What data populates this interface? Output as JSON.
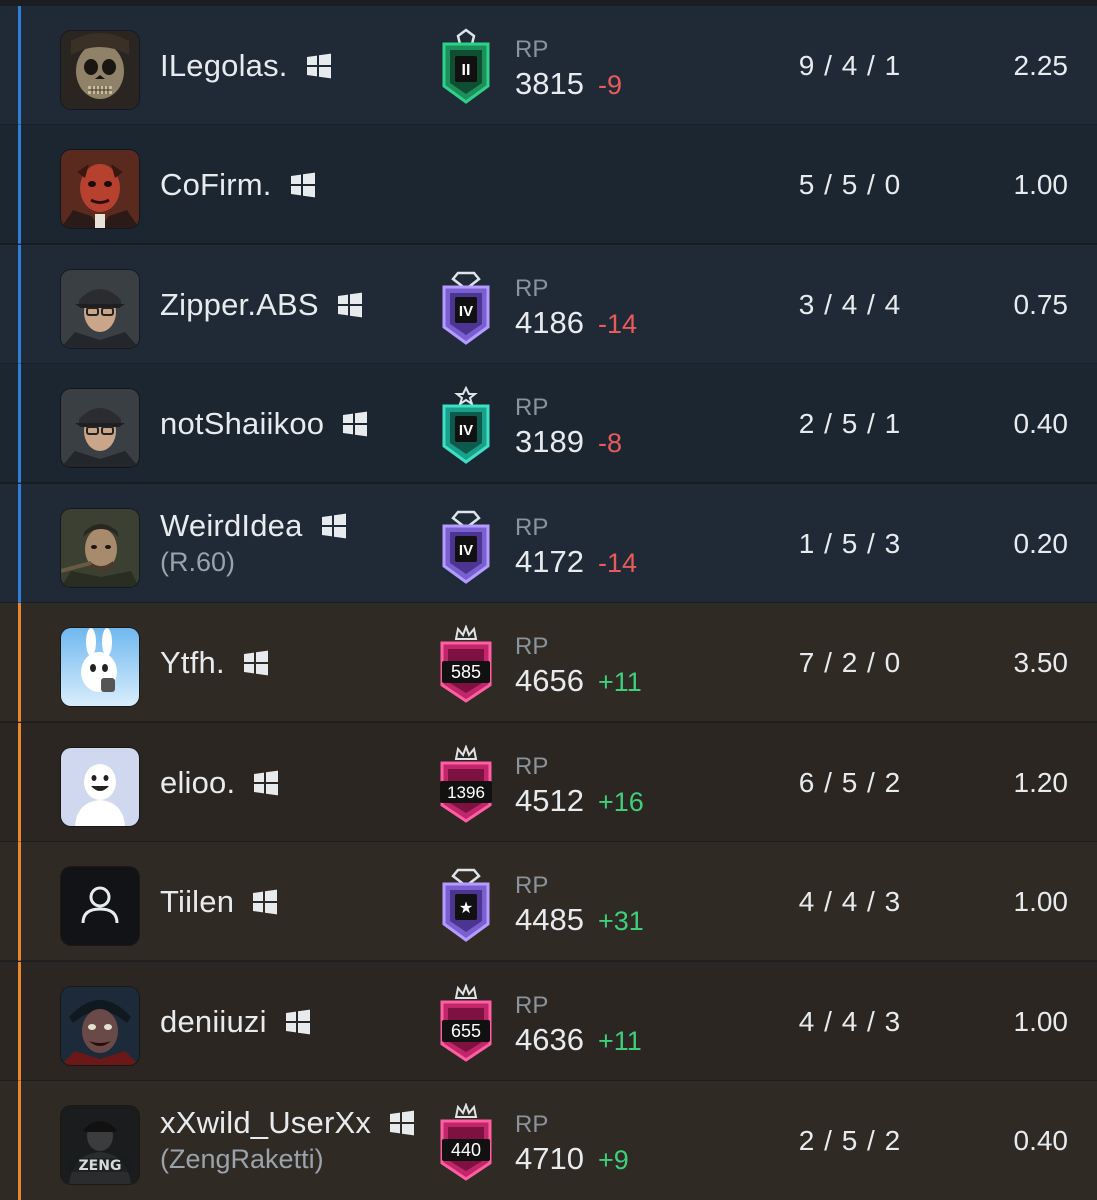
{
  "colors": {
    "team_blue": "#2f7fd6",
    "team_orange": "#e8872b",
    "rp_negative": "#e85b5b",
    "rp_positive": "#3ecf7a"
  },
  "rp_label": "RP",
  "players": [
    {
      "name": "ILegolas.",
      "platform_icon": "windows-icon",
      "sub": "",
      "rank_icon": "emerald-II-rank-icon",
      "rank_text": "II",
      "rp": "3815",
      "rp_delta": "-9",
      "kda": "9 / 4 / 1",
      "kd": "2.25",
      "team": "blue"
    },
    {
      "name": "CoFirm.",
      "platform_icon": "windows-icon",
      "sub": "",
      "rank_icon": "",
      "rank_text": "",
      "rp": "",
      "rp_delta": "",
      "kda": "5 / 5 / 0",
      "kd": "1.00",
      "team": "blue"
    },
    {
      "name": "Zipper.ABS",
      "platform_icon": "windows-icon",
      "sub": "",
      "rank_icon": "diamond-IV-rank-icon",
      "rank_text": "IV",
      "rp": "4186",
      "rp_delta": "-14",
      "kda": "3 / 4 / 4",
      "kd": "0.75",
      "team": "blue"
    },
    {
      "name": "notShaiikoo",
      "platform_icon": "windows-icon",
      "sub": "",
      "rank_icon": "emerald-IV-rank-icon",
      "rank_text": "IV",
      "rp": "3189",
      "rp_delta": "-8",
      "kda": "2 / 5 / 1",
      "kd": "0.40",
      "team": "blue"
    },
    {
      "name": "WeirdIdea",
      "platform_icon": "windows-icon",
      "sub": "(R.60)",
      "rank_icon": "diamond-IV-rank-icon",
      "rank_text": "IV",
      "rp": "4172",
      "rp_delta": "-14",
      "kda": "1 / 5 / 3",
      "kd": "0.20",
      "team": "blue"
    },
    {
      "name": "Ytfh.",
      "platform_icon": "windows-icon",
      "sub": "",
      "rank_icon": "champion-rank-icon",
      "rank_text": "585",
      "rp": "4656",
      "rp_delta": "+11",
      "kda": "7 / 2 / 0",
      "kd": "3.50",
      "team": "orange"
    },
    {
      "name": "elioo.",
      "platform_icon": "windows-icon",
      "sub": "",
      "rank_icon": "champion-rank-icon",
      "rank_text": "1396",
      "rp": "4512",
      "rp_delta": "+16",
      "kda": "6 / 5 / 2",
      "kd": "1.20",
      "team": "orange"
    },
    {
      "name": "Tiilen",
      "platform_icon": "windows-icon",
      "sub": "",
      "rank_icon": "diamond-star-rank-icon",
      "rank_text": "★",
      "rp": "4485",
      "rp_delta": "+31",
      "kda": "4 / 4 / 3",
      "kd": "1.00",
      "team": "orange"
    },
    {
      "name": "deniiuzi",
      "platform_icon": "windows-icon",
      "sub": "",
      "rank_icon": "champion-rank-icon",
      "rank_text": "655",
      "rp": "4636",
      "rp_delta": "+11",
      "kda": "4 / 4 / 3",
      "kd": "1.00",
      "team": "orange"
    },
    {
      "name": "xXwild_UserXx",
      "platform_icon": "windows-icon",
      "sub": "(ZengRaketti)",
      "rank_icon": "champion-rank-icon",
      "rank_text": "440",
      "rp": "4710",
      "rp_delta": "+9",
      "kda": "2 / 5 / 2",
      "kd": "0.40",
      "team": "orange"
    }
  ]
}
